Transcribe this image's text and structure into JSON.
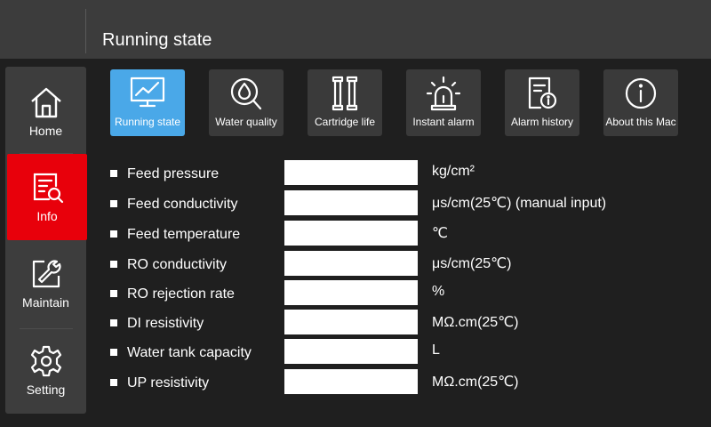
{
  "header": {
    "title": "Running state"
  },
  "sidebar": {
    "items": [
      {
        "label": "Home"
      },
      {
        "label": "Info"
      },
      {
        "label": "Maintain"
      },
      {
        "label": "Setting"
      }
    ]
  },
  "tabs": [
    {
      "label": "Running state",
      "icon": "chart-monitor-icon",
      "active": true
    },
    {
      "label": "Water quality",
      "icon": "water-drop-search-icon"
    },
    {
      "label": "Cartridge life",
      "icon": "cartridge-icon"
    },
    {
      "label": "Instant alarm",
      "icon": "alarm-light-icon"
    },
    {
      "label": "Alarm history",
      "icon": "history-document-icon"
    },
    {
      "label": "About this Mac",
      "icon": "info-icon"
    }
  ],
  "rows": [
    {
      "name": "Feed pressure",
      "value": "",
      "unit": "kg/cm²"
    },
    {
      "name": "Feed conductivity",
      "value": "",
      "unit": "μs/cm(25℃) (manual input)"
    },
    {
      "name": "Feed temperature",
      "value": "",
      "unit": "℃"
    },
    {
      "name": "RO conductivity",
      "value": "",
      "unit": "μs/cm(25℃)"
    },
    {
      "name": "RO rejection rate",
      "value": "",
      "unit": "%"
    },
    {
      "name": "DI resistivity",
      "value": "",
      "unit": "MΩ.cm(25℃)"
    },
    {
      "name": "Water tank capacity",
      "value": "",
      "unit": "L"
    },
    {
      "name": "UP resistivity",
      "value": "",
      "unit": "MΩ.cm(25℃)"
    }
  ],
  "colors": {
    "active_nav": "#e8000b",
    "active_tab": "#4aa8e8",
    "background": "#1f1f1f",
    "panel": "#3c3c3c"
  }
}
